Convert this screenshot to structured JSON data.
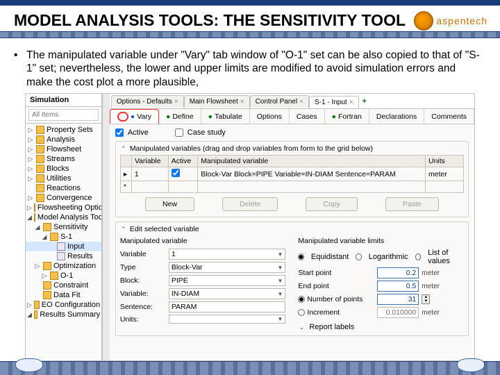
{
  "slide": {
    "title": "MODEL ANALYSIS TOOLS: THE SENSITIVITY TOOL",
    "logo_text": "aspentech",
    "bullet": "The manipulated variable under \"Vary\" tab window of \"O-1\" set can be also copied to that of \"S-1\" set; nevertheless, the lower and upper limits are modified to avoid simulation errors and make the cost plot a more plausible,"
  },
  "sidebar": {
    "header": "Simulation",
    "search_placeholder": "All Items",
    "tree": [
      {
        "tw": "▷",
        "icon": "folder",
        "label": "Property Sets",
        "depth": 0
      },
      {
        "tw": "▷",
        "icon": "folder",
        "label": "Analysis",
        "depth": 0
      },
      {
        "tw": "▷",
        "icon": "folder",
        "label": "Flowsheet",
        "depth": 0
      },
      {
        "tw": "▷",
        "icon": "folder",
        "label": "Streams",
        "depth": 0
      },
      {
        "tw": "▷",
        "icon": "folder",
        "label": "Blocks",
        "depth": 0
      },
      {
        "tw": "▷",
        "icon": "folder",
        "label": "Utilities",
        "depth": 0
      },
      {
        "tw": " ",
        "icon": "folder",
        "label": "Reactions",
        "depth": 0
      },
      {
        "tw": "▷",
        "icon": "folder",
        "label": "Convergence",
        "depth": 0
      },
      {
        "tw": "▷",
        "icon": "folder",
        "label": "Flowsheeting Options",
        "depth": 0
      },
      {
        "tw": "◢",
        "icon": "folder",
        "label": "Model Analysis Tools",
        "depth": 0
      },
      {
        "tw": "◢",
        "icon": "folder",
        "label": "Sensitivity",
        "depth": 1
      },
      {
        "tw": "◢",
        "icon": "folder",
        "label": "S-1",
        "depth": 2
      },
      {
        "tw": " ",
        "icon": "doc",
        "label": "Input",
        "depth": 3,
        "selected": true
      },
      {
        "tw": " ",
        "icon": "doc",
        "label": "Results",
        "depth": 3
      },
      {
        "tw": "▷",
        "icon": "folder",
        "label": "Optimization",
        "depth": 1
      },
      {
        "tw": "▷",
        "icon": "folder",
        "label": "O-1",
        "depth": 2
      },
      {
        "tw": " ",
        "icon": "folder",
        "label": "Constraint",
        "depth": 1
      },
      {
        "tw": " ",
        "icon": "folder",
        "label": "Data Fit",
        "depth": 1
      },
      {
        "tw": "▷",
        "icon": "folder",
        "label": "EO Configuration",
        "depth": 0
      },
      {
        "tw": "◢",
        "icon": "folder",
        "label": "Results Summary",
        "depth": 0
      }
    ]
  },
  "top_tabs": [
    {
      "label": "Options - Defaults"
    },
    {
      "label": "Main Flowsheet"
    },
    {
      "label": "Control Panel"
    },
    {
      "label": "S-1 - Input",
      "active": true
    }
  ],
  "subtabs": [
    {
      "label": "Vary",
      "check": true,
      "active": true
    },
    {
      "label": "Define",
      "check": true
    },
    {
      "label": "Tabulate",
      "check": true
    },
    {
      "label": "Options"
    },
    {
      "label": "Cases"
    },
    {
      "label": "Fortran",
      "check": true
    },
    {
      "label": "Declarations"
    },
    {
      "label": "Comments"
    }
  ],
  "form": {
    "active_label": "Active",
    "casestudy_label": "Case study",
    "manip_title": "Manipulated variables (drag and drop variables from form to the grid below)",
    "th_variable": "Variable",
    "th_active": "Active",
    "th_manvar": "Manipulated variable",
    "th_units": "Units",
    "row1_var": "1",
    "row1_man": "Block-Var Block=PIPE Variable=IN-DIAM Sentence=PARAM",
    "row1_units": "meter",
    "btn_new": "New",
    "btn_delete": "Delete",
    "btn_copy": "Copy",
    "btn_paste": "Paste",
    "edit_title": "Edit selected variable",
    "left_header": "Manipulated variable",
    "lbl_variable": "Variable",
    "val_variable": "1",
    "lbl_type": "Type",
    "val_type": "Block-Var",
    "lbl_block": "Block:",
    "val_block": "PIPE",
    "lbl_var2": "Variable:",
    "val_var2": "IN-DIAM",
    "lbl_sentence": "Sentence:",
    "val_sentence": "PARAM",
    "lbl_units": "Units:",
    "right_header": "Manipulated variable limits",
    "opt_equi": "Equidistant",
    "opt_log": "Logarithmic",
    "opt_list": "List of values",
    "lbl_start": "Start point",
    "val_start": "0.2",
    "unit_start": "meter",
    "lbl_end": "End point",
    "val_end": "0.5",
    "unit_end": "meter",
    "lbl_npts": "Number of points",
    "val_npts": "31",
    "lbl_inc": "Increment",
    "val_inc": "0.010000",
    "unit_inc": "meter",
    "report_label": "Report labels"
  }
}
